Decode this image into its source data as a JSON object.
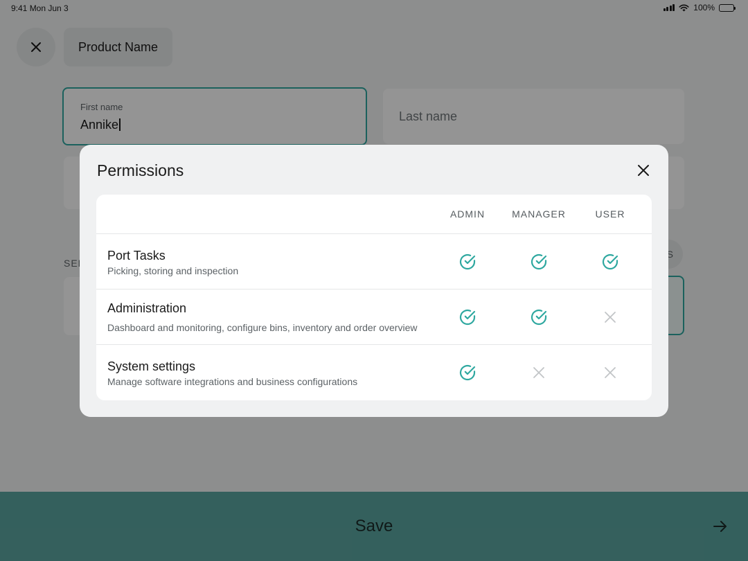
{
  "status_bar": {
    "time": "9:41  Mon Jun 3",
    "battery": "100%"
  },
  "header": {
    "product_name": "Product Name"
  },
  "form": {
    "first_name_label": "First name",
    "first_name_value": "Annike",
    "last_name_placeholder": "Last name",
    "section_label_partial": "SEL",
    "chip_partial": "S"
  },
  "footer": {
    "save_label": "Save"
  },
  "modal": {
    "title": "Permissions",
    "columns": [
      "ADMIN",
      "MANAGER",
      "USER"
    ],
    "rows": [
      {
        "title": "Port Tasks",
        "description": "Picking, storing and inspection",
        "access": [
          true,
          true,
          true
        ]
      },
      {
        "title": "Administration",
        "description": "Dashboard and monitoring, configure bins, inventory and order overview",
        "access": [
          true,
          true,
          false
        ]
      },
      {
        "title": "System settings",
        "description": "Manage software integrations and business configurations",
        "access": [
          true,
          false,
          false
        ]
      }
    ]
  },
  "colors": {
    "accent": "#2fa8a0",
    "denied": "#c2c5c7",
    "save_bar": "#5ba6a1"
  },
  "icons": {
    "granted": "check-circle-icon",
    "denied": "x-icon",
    "close": "close-icon",
    "next": "arrow-right-icon"
  }
}
